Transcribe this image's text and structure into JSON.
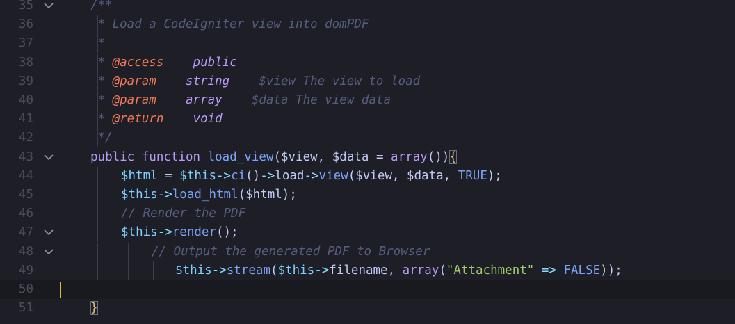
{
  "editor": {
    "lines": [
      {
        "num": "35",
        "fold": true,
        "indent": 0,
        "tokens": [
          {
            "t": "/**",
            "c": "comment"
          }
        ]
      },
      {
        "num": "36",
        "fold": false,
        "indent": 0,
        "tokens": [
          {
            "t": " * Load a CodeIgniter view into domPDF",
            "c": "comment"
          }
        ]
      },
      {
        "num": "37",
        "fold": false,
        "indent": 0,
        "tokens": [
          {
            "t": " *",
            "c": "comment"
          }
        ]
      },
      {
        "num": "38",
        "fold": false,
        "indent": 0,
        "tokens": [
          {
            "t": " * ",
            "c": "comment"
          },
          {
            "t": "@access",
            "c": "tag"
          },
          {
            "t": "    ",
            "c": "comment"
          },
          {
            "t": "public",
            "c": "type"
          }
        ]
      },
      {
        "num": "39",
        "fold": false,
        "indent": 0,
        "tokens": [
          {
            "t": " * ",
            "c": "comment"
          },
          {
            "t": "@param",
            "c": "tag"
          },
          {
            "t": "    ",
            "c": "comment"
          },
          {
            "t": "string",
            "c": "type"
          },
          {
            "t": "    $view The view to load",
            "c": "comment"
          }
        ]
      },
      {
        "num": "40",
        "fold": false,
        "indent": 0,
        "tokens": [
          {
            "t": " * ",
            "c": "comment"
          },
          {
            "t": "@param",
            "c": "tag"
          },
          {
            "t": "    ",
            "c": "comment"
          },
          {
            "t": "array",
            "c": "type"
          },
          {
            "t": "    $data The view data",
            "c": "comment"
          }
        ]
      },
      {
        "num": "41",
        "fold": false,
        "indent": 0,
        "tokens": [
          {
            "t": " * ",
            "c": "comment"
          },
          {
            "t": "@return",
            "c": "tag"
          },
          {
            "t": "    ",
            "c": "comment"
          },
          {
            "t": "void",
            "c": "type"
          }
        ]
      },
      {
        "num": "42",
        "fold": false,
        "indent": 0,
        "tokens": [
          {
            "t": " */",
            "c": "comment"
          }
        ]
      },
      {
        "num": "43",
        "fold": true,
        "indent": 0,
        "tokens": [
          {
            "t": "public",
            "c": "kw"
          },
          {
            "t": " ",
            "c": "plain"
          },
          {
            "t": "function",
            "c": "kw"
          },
          {
            "t": " ",
            "c": "plain"
          },
          {
            "t": "load_view",
            "c": "fn"
          },
          {
            "t": "(",
            "c": "plain"
          },
          {
            "t": "$view",
            "c": "plain"
          },
          {
            "t": ", ",
            "c": "plain"
          },
          {
            "t": "$data",
            "c": "plain"
          },
          {
            "t": " = ",
            "c": "plain"
          },
          {
            "t": "array",
            "c": "kw"
          },
          {
            "t": "())",
            "c": "plain"
          },
          {
            "t": "{",
            "c": "bracket"
          }
        ]
      },
      {
        "num": "44",
        "fold": false,
        "indent": 1,
        "tokens": [
          {
            "t": "$html",
            "c": "var"
          },
          {
            "t": " = ",
            "c": "plain"
          },
          {
            "t": "$this",
            "c": "var"
          },
          {
            "t": "->",
            "c": "op"
          },
          {
            "t": "ci",
            "c": "fn"
          },
          {
            "t": "()",
            "c": "plain"
          },
          {
            "t": "->",
            "c": "op"
          },
          {
            "t": "load",
            "c": "plain"
          },
          {
            "t": "->",
            "c": "op"
          },
          {
            "t": "view",
            "c": "fn"
          },
          {
            "t": "($view, $data, ",
            "c": "plain"
          },
          {
            "t": "TRUE",
            "c": "const"
          },
          {
            "t": ");",
            "c": "plain"
          }
        ]
      },
      {
        "num": "45",
        "fold": false,
        "indent": 1,
        "tokens": [
          {
            "t": "$this",
            "c": "var"
          },
          {
            "t": "->",
            "c": "op"
          },
          {
            "t": "load_html",
            "c": "fn"
          },
          {
            "t": "($html);",
            "c": "plain"
          }
        ]
      },
      {
        "num": "46",
        "fold": false,
        "indent": 1,
        "tokens": [
          {
            "t": "// Render the PDF",
            "c": "comment"
          }
        ]
      },
      {
        "num": "47",
        "fold": true,
        "indent": 1,
        "tokens": [
          {
            "t": "$this",
            "c": "var"
          },
          {
            "t": "->",
            "c": "op"
          },
          {
            "t": "render",
            "c": "fn"
          },
          {
            "t": "();",
            "c": "plain"
          }
        ]
      },
      {
        "num": "48",
        "fold": true,
        "indent": 2,
        "tokens": [
          {
            "t": "// Output the generated PDF to Browser",
            "c": "comment"
          }
        ]
      },
      {
        "num": "49",
        "fold": false,
        "indent": 3,
        "tokens": [
          {
            "t": "$this",
            "c": "var"
          },
          {
            "t": "->",
            "c": "op"
          },
          {
            "t": "stream",
            "c": "fn"
          },
          {
            "t": "(",
            "c": "plain"
          },
          {
            "t": "$this",
            "c": "var"
          },
          {
            "t": "->",
            "c": "op"
          },
          {
            "t": "filename, ",
            "c": "plain"
          },
          {
            "t": "array",
            "c": "kw"
          },
          {
            "t": "(",
            "c": "plain"
          },
          {
            "t": "\"Attachment\"",
            "c": "str"
          },
          {
            "t": " => ",
            "c": "op"
          },
          {
            "t": "FALSE",
            "c": "const"
          },
          {
            "t": "));",
            "c": "plain"
          }
        ]
      },
      {
        "num": "50",
        "fold": false,
        "indent": 0,
        "current": true,
        "tokens": []
      },
      {
        "num": "51",
        "fold": false,
        "indent": 0,
        "tokens": [
          {
            "t": "}",
            "c": "bracket"
          }
        ]
      }
    ],
    "colors": {
      "background": "#1e1f26",
      "current_line": "#191a20",
      "gutter_text": "#4a4d5a",
      "caret": "#e5b830"
    },
    "fold_icon": "chevron-down-icon"
  }
}
